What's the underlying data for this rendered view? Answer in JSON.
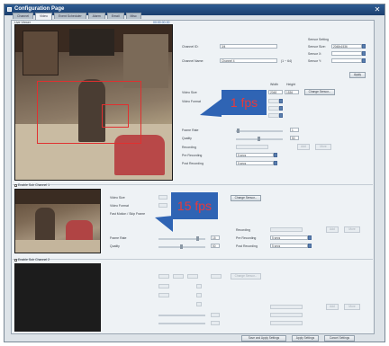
{
  "window": {
    "title": "Configuration Page",
    "close_glyph": "✕"
  },
  "tabs": [
    {
      "label": "Channel",
      "active": false
    },
    {
      "label": "Video",
      "active": true
    },
    {
      "label": "Event Scheduler",
      "active": false
    },
    {
      "label": "Alarm",
      "active": false
    },
    {
      "label": "Email",
      "active": false
    },
    {
      "label": "Misc",
      "active": false
    }
  ],
  "channel": {
    "live_viewer_label": "Live Viewer",
    "live_viewer_value": "00:00:00.00",
    "channel_id_label": "Channel ID:",
    "channel_id_value": "3/4",
    "channel_name_label": "Channel Name:",
    "channel_name_value": "Channel 4",
    "channel_name_hint": "(1 ~ 64)",
    "sensor_setting_label": "Sensor Setting",
    "sensor_size_label": "Sensor Size:",
    "sensor_size_value": "2048x1536",
    "sensor_x_label": "Sensor X:",
    "sensor_y_label": "Sensor Y:",
    "apply_label": "Apply"
  },
  "main_stream": {
    "width_label": "Width",
    "height_label": "Height",
    "video_size_label": "Video Size",
    "width_value": "2048",
    "height_value": "1536",
    "change_sensor_label": "Change Sensor...",
    "video_format_label": "Video Format",
    "frame_rate_label": "Frame Rate",
    "frame_rate_value": "1",
    "quality_label": "Quality",
    "quality_value": "50",
    "recording_label": "Recording",
    "pre_recording_label": "Pre Recording",
    "pre_recording_value": "5 secs",
    "post_recording_label": "Post Recording",
    "post_recording_value": "5 secs",
    "add_label": "Add",
    "more_label": "More"
  },
  "sub_channel_1": {
    "enable_label": "Enable Sub Channel 1",
    "video_size_label": "Video Size",
    "video_format_label": "Video Format",
    "fast_motion_label": "Fast Motion / Skip Frame",
    "change_sensor_label": "Change Sensor...",
    "frame_rate_label": "Frame Rate",
    "frame_rate_value": "15",
    "quality_label": "Quality",
    "quality_value": "50",
    "recording_label": "Recording",
    "pre_recording_label": "Pre Recording",
    "pre_recording_value": "5 secs",
    "post_recording_label": "Post Recording",
    "post_recording_value": "5 secs",
    "add_label": "Add",
    "more_label": "More"
  },
  "sub_channel_2": {
    "enable_label": "Enable Sub Channel 2",
    "change_sensor_label": "Change Sensor...",
    "add_label": "Add",
    "more_label": "More"
  },
  "callouts": {
    "main_fps": "1 fps",
    "sub_fps": "15 fps"
  },
  "footer": {
    "save_label": "Save and Apply Settings",
    "apply_label": "Apply Settings",
    "cancel_label": "Cancel Settings"
  },
  "colors": {
    "callout_bg": "#2f64b4",
    "callout_text": "#e8393a",
    "titlebar": "#1c3f6e"
  }
}
